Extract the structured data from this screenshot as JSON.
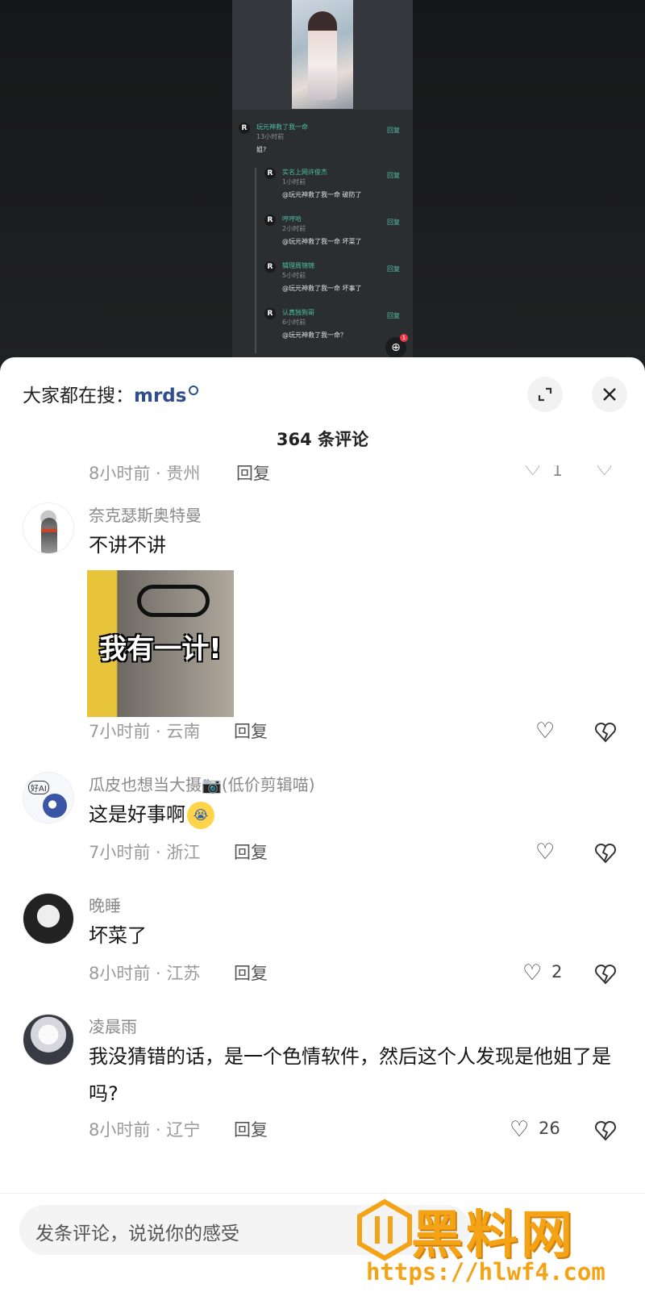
{
  "embedded": {
    "comments": [
      {
        "avatar": "R",
        "name": "玩元神救了我一命",
        "time": "13小时前",
        "text": "姐?",
        "reply": "回复"
      },
      {
        "avatar": "R",
        "name": "实名上网许俊杰",
        "time": "1小时前",
        "text": "@玩元神救了我一命 破防了",
        "reply": "回复"
      },
      {
        "avatar": "R",
        "name": "哼哼哈",
        "time": "2小时前",
        "text": "@玩元神救了我一命 坏菜了",
        "reply": "回复"
      },
      {
        "avatar": "R",
        "name": "辑理周锦锦",
        "time": "5小时前",
        "text": "@玩元神救了我一命 坏事了",
        "reply": "回复"
      },
      {
        "avatar": "R",
        "name": "认真独狗哥",
        "time": "6小时前",
        "text": "@玩元神救了我一命？",
        "reply": "回复"
      }
    ],
    "badge": "1"
  },
  "sheet": {
    "search_label": "大家都在搜：",
    "search_keyword": "mrds",
    "count": "364 条评论"
  },
  "clipped": {
    "meta": "8小时前 · 贵州",
    "reply": "回复",
    "likes": "1"
  },
  "comments": [
    {
      "user": "奈克瑟斯奥特曼",
      "text": "不讲不讲",
      "sticker_caption": "我有一计!",
      "meta": "7小时前 · 云南",
      "reply": "回复",
      "likes": ""
    },
    {
      "user": "瓜皮也想当大摄📷(低价剪辑喵)",
      "text": "这是好事啊",
      "avatar_tag": "好AI",
      "meta": "7小时前 · 浙江",
      "reply": "回复",
      "likes": ""
    },
    {
      "user": "晚睡",
      "text": "坏菜了",
      "meta": "8小时前 · 江苏",
      "reply": "回复",
      "likes": "2"
    },
    {
      "user": "凌晨雨",
      "text": "我没猜错的话，是一个色情软件，然后这个人发现是他姐了是吗?",
      "meta": "8小时前 · 辽宁",
      "reply": "回复",
      "likes": "26"
    }
  ],
  "input": {
    "placeholder": "发条评论，说说你的感受"
  },
  "watermark": {
    "text": "黑料网",
    "url": "https://hlwf4.com"
  },
  "icons": [
    "expand-icon",
    "close-icon",
    "heart-icon",
    "broken-heart-icon",
    "search-icon"
  ]
}
